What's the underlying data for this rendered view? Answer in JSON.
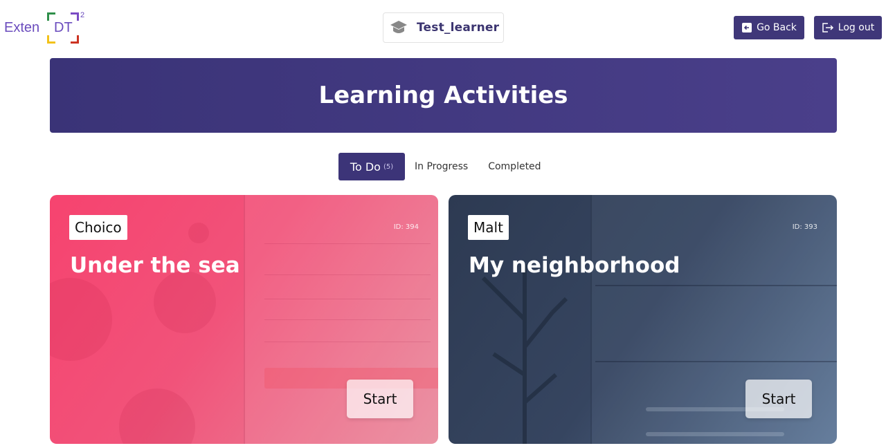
{
  "logo": {
    "prefix": "Exten",
    "core": "DT",
    "superscript": "2"
  },
  "header": {
    "user_name": "Test_learner",
    "user_icon": "graduation-cap-icon",
    "go_back_label": "Go Back",
    "go_back_icon": "arrow-left-icon",
    "logout_label": "Log out",
    "logout_icon": "logout-icon"
  },
  "banner": {
    "title": "Learning Activities"
  },
  "tabs": {
    "todo": {
      "label": "To Do",
      "count": "(5)"
    },
    "in_progress": {
      "label": "In Progress"
    },
    "completed": {
      "label": "Completed"
    }
  },
  "cards": [
    {
      "tag": "Choico",
      "id_label": "ID: 394",
      "title": "Under the sea",
      "start_label": "Start"
    },
    {
      "tag": "Malt",
      "id_label": "ID: 393",
      "title": "My neighborhood",
      "start_label": "Start"
    }
  ],
  "colors": {
    "accent": "#3f3779",
    "card1": "#f6436f",
    "card2": "#2d3a52"
  }
}
